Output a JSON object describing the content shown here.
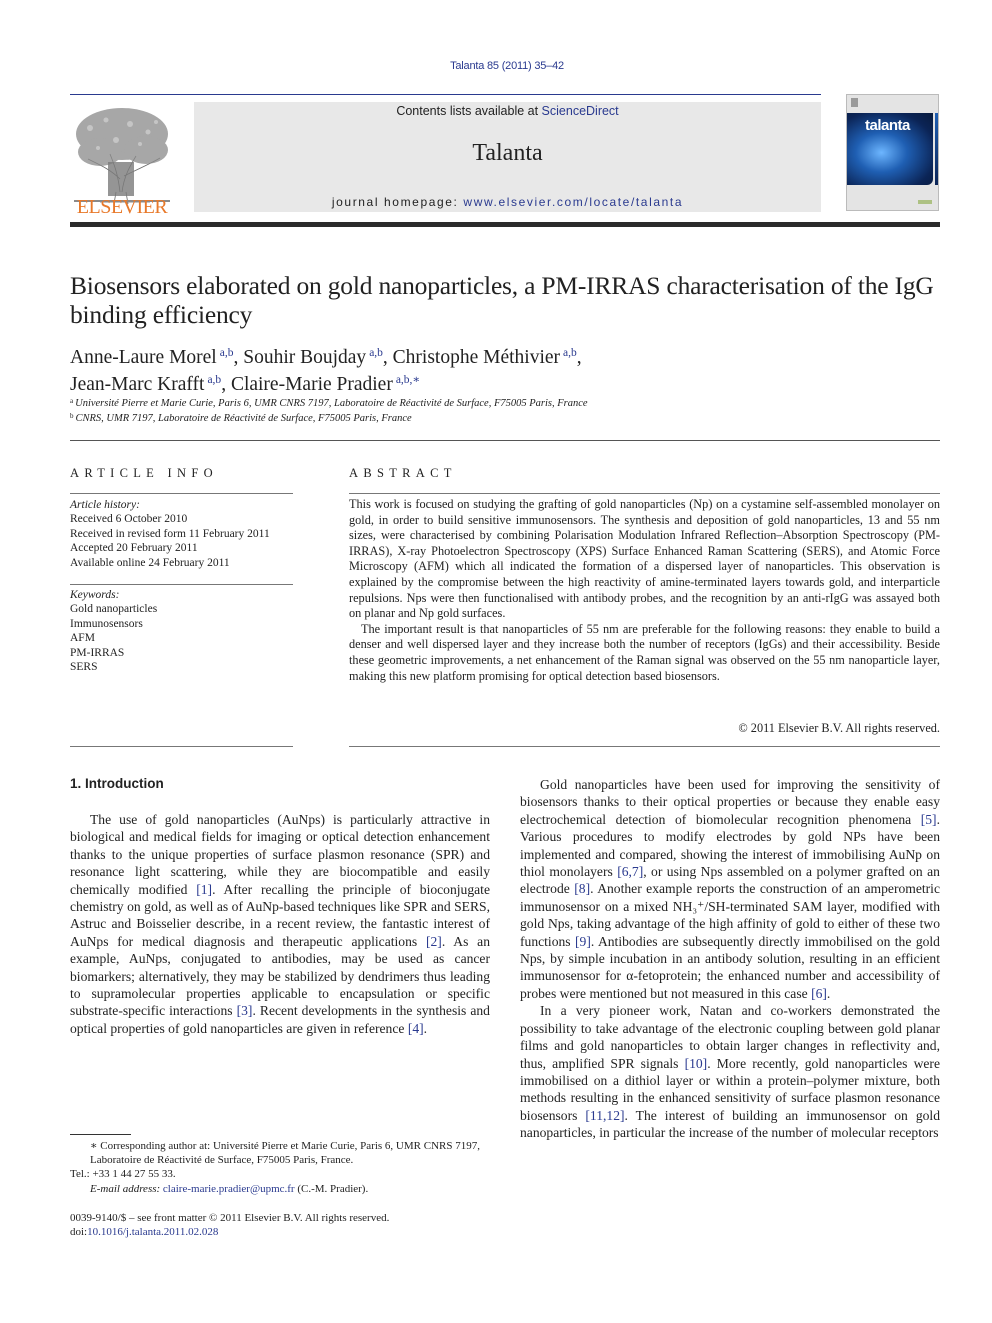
{
  "header": {
    "citation": "Talanta 85 (2011) 35–42",
    "contents_prefix": "Contents lists available at ",
    "contents_link": "ScienceDirect",
    "journal_title": "Talanta",
    "homepage_prefix": "journal homepage: ",
    "homepage_url": "www.elsevier.com/locate/talanta",
    "publisher_logo_text": "ELSEVIER",
    "cover_title": "talanta",
    "colors": {
      "link": "#2a3a8f",
      "publisher_orange": "#e8792a",
      "banner_bg": "#e8e8e8",
      "cover_blue": "#1f5fb3"
    }
  },
  "article": {
    "title": "Biosensors elaborated on gold nanoparticles, a PM-IRRAS characterisation of the IgG binding efficiency",
    "authors": [
      {
        "name": "Anne-Laure Morel",
        "sup": "a,b",
        "sep": ", "
      },
      {
        "name": "Souhir Boujday",
        "sup": "a,b",
        "sep": ", "
      },
      {
        "name": "Christophe Méthivier",
        "sup": "a,b",
        "sep": ","
      },
      {
        "name": "Jean-Marc Krafft",
        "sup": "a,b",
        "sep": ", "
      },
      {
        "name": "Claire-Marie Pradier",
        "sup": "a,b,∗",
        "sep": ""
      }
    ],
    "affiliations": [
      {
        "mark": "a",
        "text": "Université Pierre et Marie Curie, Paris 6, UMR CNRS 7197, Laboratoire de Réactivité de Surface, F75005 Paris, France"
      },
      {
        "mark": "b",
        "text": "CNRS, UMR 7197, Laboratoire de Réactivité de Surface, F75005 Paris, France"
      }
    ]
  },
  "article_info": {
    "heading": "ARTICLE INFO",
    "history_label": "Article history:",
    "history": [
      "Received 6 October 2010",
      "Received in revised form 11 February 2011",
      "Accepted 20 February 2011",
      "Available online 24 February 2011"
    ],
    "keywords_label": "Keywords:",
    "keywords": [
      "Gold nanoparticles",
      "Immunosensors",
      "AFM",
      "PM-IRRAS",
      "SERS"
    ]
  },
  "abstract": {
    "heading": "ABSTRACT",
    "p1": "This work is focused on studying the grafting of gold nanoparticles (Np) on a cystamine self-assembled monolayer on gold, in order to build sensitive immunosensors. The synthesis and deposition of gold nanoparticles, 13 and 55 nm sizes, were characterised by combining Polarisation Modulation Infrared Reflection–Absorption Spectroscopy (PM-IRRAS), X-ray Photoelectron Spectroscopy (XPS) Surface Enhanced Raman Scattering (SERS), and Atomic Force Microscopy (AFM) which all indicated the formation of a dispersed layer of nanoparticles. This observation is explained by the compromise between the high reactivity of amine-terminated layers towards gold, and interparticle repulsions. Nps were then functionalised with antibody probes, and the recognition by an anti-rIgG was assayed both on planar and Np gold surfaces.",
    "p2": "The important result is that nanoparticles of 55 nm are preferable for the following reasons: they enable to build a denser and well dispersed layer and they increase both the number of receptors (IgGs) and their accessibility. Beside these geometric improvements, a net enhancement of the Raman signal was observed on the 55 nm nanoparticle layer, making this new platform promising for optical detection based biosensors.",
    "copyright": "© 2011 Elsevier B.V. All rights reserved."
  },
  "introduction": {
    "heading": "1.  Introduction",
    "left_paragraph": [
      {
        "t": "The use of gold nanoparticles (AuNps) is particularly attractive in biological and medical fields for imaging or optical detection enhancement thanks to the unique properties of surface plasmon resonance (SPR) and resonance light scattering, while they are biocompatible and easily chemically modified "
      },
      {
        "ref": "[1]"
      },
      {
        "t": ". After recalling the principle of bioconjugate chemistry on gold, as well as of AuNp-based techniques like SPR and SERS, Astruc and Boisselier describe, in a recent review, the fantastic interest of AuNps for medical diagnosis and therapeutic applications "
      },
      {
        "ref": "[2]"
      },
      {
        "t": ". As an example, AuNps, conjugated to antibodies, may be used as cancer biomarkers; alternatively, they may be stabilized by dendrimers thus leading to supramolecular properties applicable to encapsulation or specific substrate-specific interactions "
      },
      {
        "ref": "[3]"
      },
      {
        "t": ". Recent developments in the synthesis and optical properties of gold nanoparticles are given in reference "
      },
      {
        "ref": "[4]"
      },
      {
        "t": "."
      }
    ],
    "right_paragraph_1": [
      {
        "t": "Gold nanoparticles have been used for improving the sensitivity of biosensors thanks to their optical properties or because they enable easy electrochemical detection of biomolecular recognition phenomena "
      },
      {
        "ref": "[5]"
      },
      {
        "t": ". Various procedures to modify electrodes by gold NPs have been implemented and compared, showing the interest of immobilising AuNp on thiol monolayers "
      },
      {
        "ref": "[6,7]"
      },
      {
        "t": ", or using Nps assembled on a polymer grafted on an electrode "
      },
      {
        "ref": "[8]"
      },
      {
        "t": ". Another example reports the construction of an amperometric immunosensor on a mixed NH₃⁺/SH-terminated SAM layer, modified with gold Nps, taking advantage of the high affinity of gold to either of these two functions "
      },
      {
        "ref": "[9]"
      },
      {
        "t": ". Antibodies are subsequently directly immobilised on the gold Nps, by simple incubation in an antibody solution, resulting in an efficient immunosensor for α-fetoprotein; the enhanced number and accessibility of probes were mentioned but not measured in this case "
      },
      {
        "ref": "[6]"
      },
      {
        "t": "."
      }
    ],
    "right_paragraph_2": [
      {
        "t": "In a very pioneer work, Natan and co-workers demonstrated the possibility to take advantage of the electronic coupling between gold planar films and gold nanoparticles to obtain larger changes in reflectivity and, thus, amplified SPR signals "
      },
      {
        "ref": "[10]"
      },
      {
        "t": ". More recently, gold nanoparticles were immobilised on a dithiol layer or within a protein–polymer mixture, both methods resulting in the enhanced sensitivity of surface plasmon resonance biosensors "
      },
      {
        "ref": "[11,12]"
      },
      {
        "t": ". The interest of building an immunosensor on gold nanoparticles, in particular the increase of the number of molecular receptors"
      }
    ]
  },
  "footnotes": {
    "corresponding": "∗ Corresponding author at: Université Pierre et Marie Curie, Paris 6, UMR CNRS 7197, Laboratoire de Réactivité de Surface, F75005 Paris, France.",
    "tel": "Tel.: +33 1 44 27 55 33.",
    "email_label": "E-mail address: ",
    "email": "claire-marie.pradier@upmc.fr",
    "email_suffix": " (C.-M. Pradier).",
    "issn_line": "0039-9140/$ – see front matter © 2011 Elsevier B.V. All rights reserved.",
    "doi_prefix": "doi:",
    "doi": "10.1016/j.talanta.2011.02.028"
  }
}
